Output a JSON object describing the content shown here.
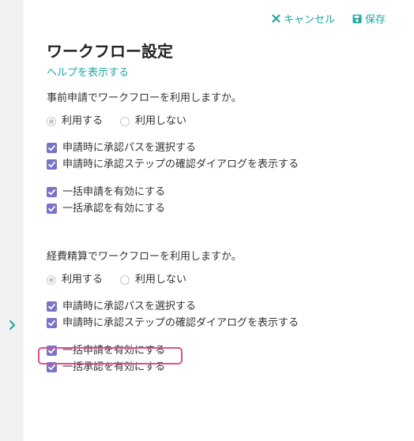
{
  "actions": {
    "cancel_label": "キャンセル",
    "save_label": "保存"
  },
  "page": {
    "title": "ワークフロー設定",
    "help_link": "ヘルプを表示する"
  },
  "sections": [
    {
      "question": "事前申請でワークフローを利用しますか。",
      "radio_use": "利用する",
      "radio_not_use": "利用しない",
      "selected": "利用する",
      "checkbox_groups": [
        [
          "申請時に承認パスを選択する",
          "申請時に承認ステップの確認ダイアログを表示する"
        ],
        [
          "一括申請を有効にする",
          "一括承認を有効にする"
        ]
      ]
    },
    {
      "question": "経費精算でワークフローを利用しますか。",
      "radio_use": "利用する",
      "radio_not_use": "利用しない",
      "selected": "利用する",
      "checkbox_groups": [
        [
          "申請時に承認パスを選択する",
          "申請時に承認ステップの確認ダイアログを表示する"
        ],
        [
          "一括申請を有効にする",
          "一括承認を有効にする"
        ]
      ]
    }
  ],
  "colors": {
    "accent": "#1fa6a6",
    "checkbox": "#7a73c8",
    "highlight": "#e04f8b",
    "rail": "#f1f1f1"
  },
  "icons": {
    "cancel": "close-icon",
    "save": "floppy-disk-icon",
    "rail": "chevron-right-icon"
  }
}
